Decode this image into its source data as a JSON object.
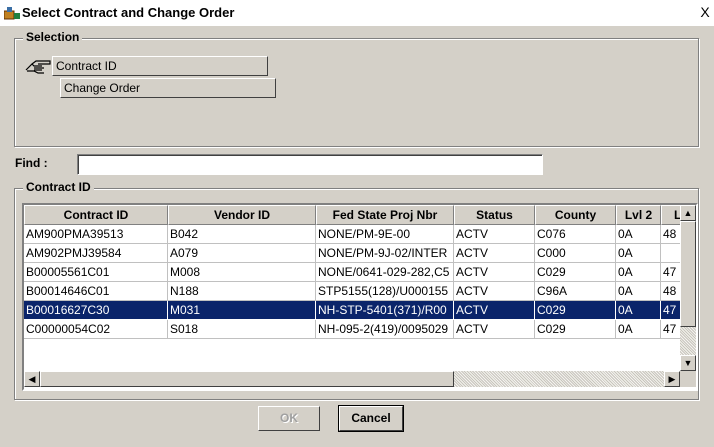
{
  "window": {
    "title": "Select Contract and Change Order",
    "close_label": "X"
  },
  "selection": {
    "legend": "Selection",
    "buttons": [
      {
        "label": "Contract ID"
      },
      {
        "label": "Change Order"
      }
    ]
  },
  "find": {
    "label": "Find :",
    "value": ""
  },
  "grid": {
    "legend": "Contract ID",
    "columns": [
      "Contract ID",
      "Vendor ID",
      "Fed State Proj Nbr",
      "Status",
      "County",
      "Lvl 2",
      "Lv"
    ],
    "rows": [
      [
        "AM900PMA39513",
        "B042",
        "NONE/PM-9E-00",
        "ACTV",
        "C076",
        "0A",
        "48"
      ],
      [
        "AM902PMJ39584",
        "A079",
        "NONE/PM-9J-02/INTER",
        "ACTV",
        "C000",
        "0A",
        ""
      ],
      [
        "B00005561C01",
        "M008",
        "NONE/0641-029-282,C5",
        "ACTV",
        "C029",
        "0A",
        "47"
      ],
      [
        "B00014646C01",
        "N188",
        "STP5155(128)/U000155",
        "ACTV",
        "C96A",
        "0A",
        "48"
      ],
      [
        "B00016627C30",
        "M031",
        "NH-STP-5401(371)/R00",
        "ACTV",
        "C029",
        "0A",
        "47"
      ],
      [
        "C00000054C02",
        "S018",
        "NH-095-2(419)/0095029",
        "ACTV",
        "C029",
        "0A",
        "47"
      ]
    ],
    "selected_row_index": 4
  },
  "buttons": {
    "ok": "OK",
    "cancel": "Cancel"
  }
}
